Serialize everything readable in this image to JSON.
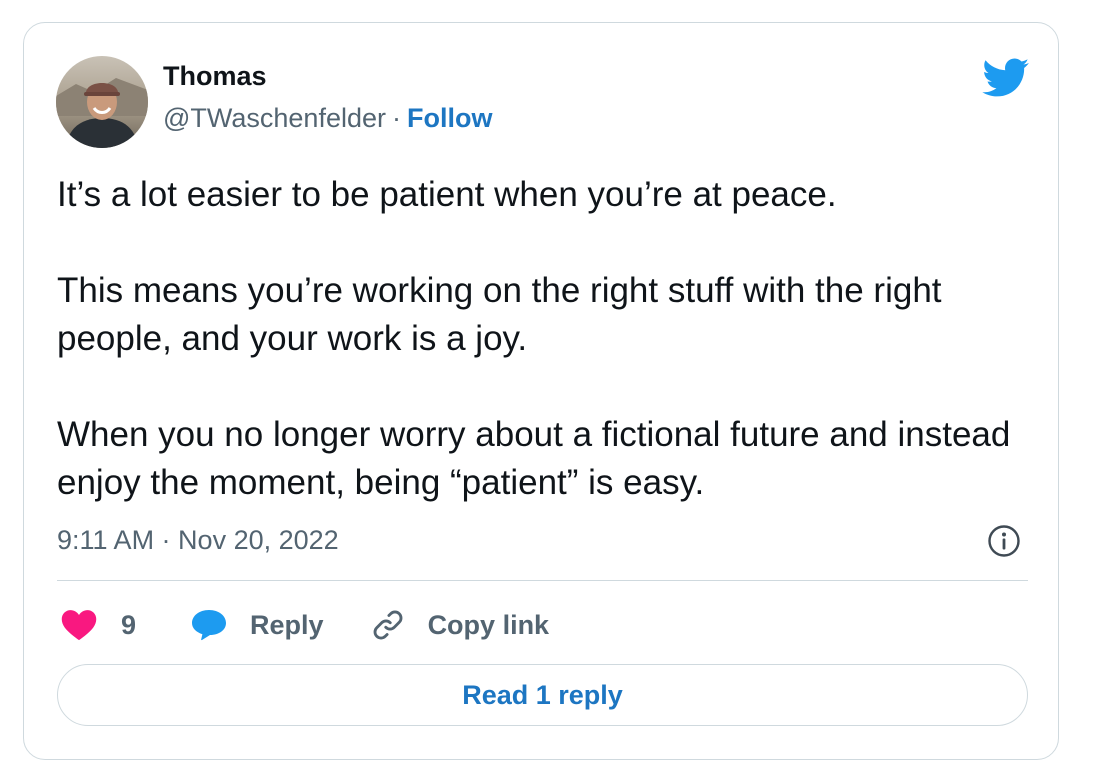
{
  "author": {
    "name": "Thomas",
    "handle": "@TWaschenfelder",
    "separator": "·",
    "follow_label": "Follow"
  },
  "tweet": {
    "paragraphs": [
      "It’s a lot easier to be patient when you’re at peace.",
      "This means you’re working on the right stuff with the right people, and your work is a joy.",
      "When you no longer worry about a fictional future and instead enjoy the moment, being “patient” is easy."
    ],
    "timestamp": "9:11 AM · Nov 20, 2022"
  },
  "actions": {
    "like_count": "9",
    "reply_label": "Reply",
    "copy_link_label": "Copy link",
    "read_replies_label": "Read 1 reply"
  },
  "icons": {
    "brand": "twitter-bird-icon",
    "like": "heart-icon",
    "reply": "speech-bubble-icon",
    "copy": "link-icon",
    "info": "info-icon"
  },
  "colors": {
    "brand_blue": "#1d9bf0",
    "link_blue": "#1d76c2",
    "like_pink": "#f91880",
    "secondary_text": "#536471",
    "border": "#cfd9de"
  }
}
